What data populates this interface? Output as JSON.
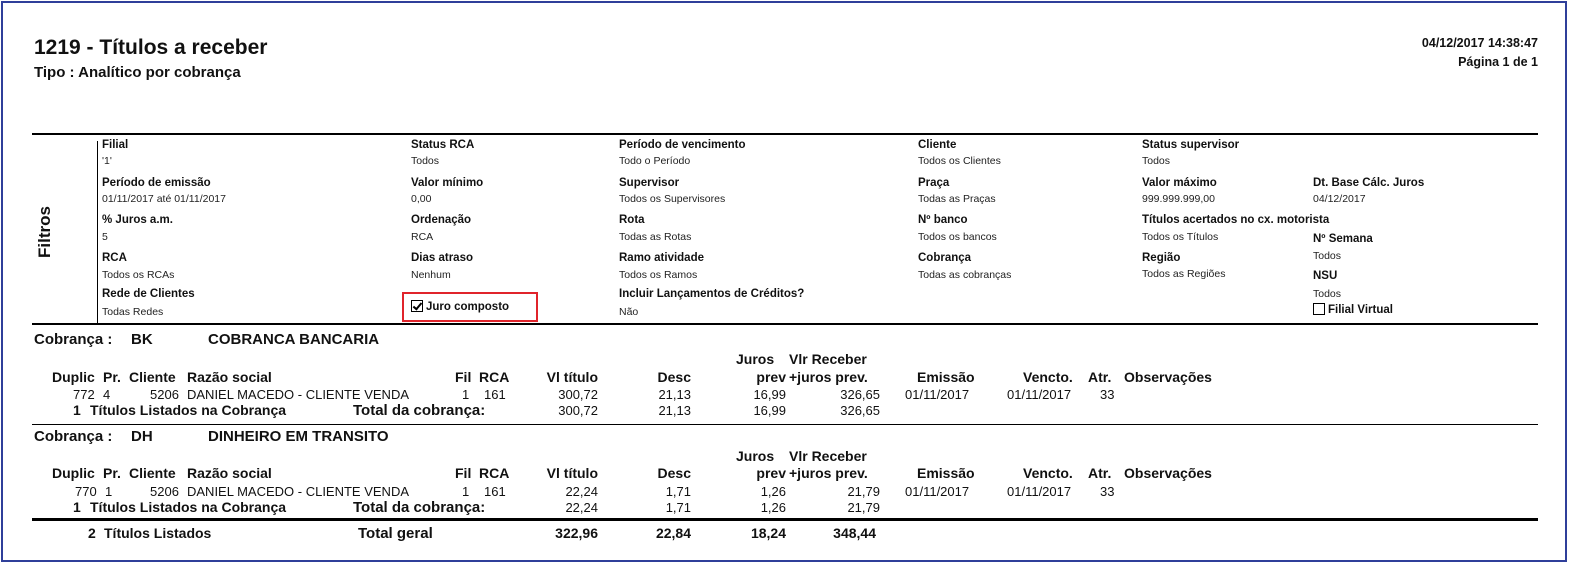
{
  "report": {
    "title": "1219 - Títulos a receber",
    "subtitle": "Tipo : Analítico por cobrança",
    "datetime": "04/12/2017 14:38:47",
    "page": "Página 1 de 1"
  },
  "filters": {
    "label": "Filtros",
    "filial": {
      "label": "Filial",
      "value": "'1'"
    },
    "periodo_emissao": {
      "label": "Período de emissão",
      "value": "01/11/2017 até 01/11/2017"
    },
    "juros_am": {
      "label": "% Juros a.m.",
      "value": "5"
    },
    "rca": {
      "label": "RCA",
      "value": "Todos os RCAs"
    },
    "rede_clientes": {
      "label": "Rede de Clientes",
      "value": "Todas Redes"
    },
    "status_rca": {
      "label": "Status RCA",
      "value": "Todos"
    },
    "valor_minimo": {
      "label": "Valor mínimo",
      "value": "0,00"
    },
    "ordenacao": {
      "label": "Ordenação",
      "value": "RCA"
    },
    "dias_atraso": {
      "label": "Dias atraso",
      "value": "Nenhum"
    },
    "juro_composto": {
      "label": "Juro composto",
      "checked": true
    },
    "periodo_vencimento": {
      "label": "Período de vencimento",
      "value": "Todo o Período"
    },
    "supervisor": {
      "label": "Supervisor",
      "value": "Todos os Supervisores"
    },
    "rota": {
      "label": "Rota",
      "value": "Todas as Rotas"
    },
    "ramo_atividade": {
      "label": "Ramo atividade",
      "value": "Todos os Ramos"
    },
    "incluir_lancamentos": {
      "label": "Incluir Lançamentos de Créditos?",
      "value": "Não"
    },
    "cliente": {
      "label": "Cliente",
      "value": "Todos os Clientes"
    },
    "praca": {
      "label": "Praça",
      "value": "Todas as Praças"
    },
    "n_banco": {
      "label": "Nº banco",
      "value": "Todos os bancos"
    },
    "cobranca": {
      "label": "Cobrança",
      "value": "Todas as cobranças"
    },
    "status_supervisor": {
      "label": "Status supervisor",
      "value": "Todos"
    },
    "valor_maximo": {
      "label": "Valor máximo",
      "value": "999.999.999,00"
    },
    "titulos_acertados": {
      "label": "Títulos acertados no cx. motorista",
      "value": "Todos os Títulos"
    },
    "regiao": {
      "label": "Região",
      "value": "Todos as Regiões"
    },
    "dt_base": {
      "label": "Dt. Base Cálc. Juros",
      "value": "04/12/2017"
    },
    "n_semana": {
      "label": "Nº Semana",
      "value": "Todos"
    },
    "nsu": {
      "label": "NSU",
      "value": "Todos"
    },
    "filial_virtual": {
      "label": "Filial Virtual",
      "checked": false
    }
  },
  "columns": {
    "duplic": "Duplic",
    "pr": "Pr.",
    "cliente": "Cliente",
    "razao": "Razão social",
    "fil": "Fil",
    "rca": "RCA",
    "vl_titulo": "Vl título",
    "desc": "Desc",
    "juros_1": "Juros",
    "juros_2": "prev",
    "vlr_1": "Vlr Receber",
    "vlr_2": "+juros prev.",
    "emissao": "Emissão",
    "vencto": "Vencto.",
    "atr": "Atr.",
    "obs": "Observações"
  },
  "sections": [
    {
      "label": "Cobrança :",
      "code": "BK",
      "name": "COBRANCA BANCARIA",
      "row": {
        "duplic": "772",
        "pr": "4",
        "cliente": "5206",
        "razao": "DANIEL MACEDO - CLIENTE VENDA",
        "fil": "1",
        "rca": "161",
        "vl_titulo": "300,72",
        "desc": "21,13",
        "juros": "16,99",
        "vlr": "326,65",
        "emissao": "01/11/2017",
        "vencto": "01/11/2017",
        "atr": "33"
      },
      "summary": {
        "count": "1",
        "listed": "Títulos Listados na Cobrança",
        "total_label": "Total da cobrança:",
        "vl_titulo": "300,72",
        "desc": "21,13",
        "juros": "16,99",
        "vlr": "326,65"
      }
    },
    {
      "label": "Cobrança :",
      "code": "DH",
      "name": "DINHEIRO EM TRANSITO",
      "row": {
        "duplic": "770",
        "pr": "1",
        "cliente": "5206",
        "razao": "DANIEL MACEDO - CLIENTE VENDA",
        "fil": "1",
        "rca": "161",
        "vl_titulo": "22,24",
        "desc": "1,71",
        "juros": "1,26",
        "vlr": "21,79",
        "emissao": "01/11/2017",
        "vencto": "01/11/2017",
        "atr": "33"
      },
      "summary": {
        "count": "1",
        "listed": "Títulos Listados na Cobrança",
        "total_label": "Total da cobrança:",
        "vl_titulo": "22,24",
        "desc": "1,71",
        "juros": "1,26",
        "vlr": "21,79"
      }
    }
  ],
  "grand_total": {
    "count": "2",
    "listed": "Títulos Listados",
    "label": "Total geral",
    "vl_titulo": "322,96",
    "desc": "22,84",
    "juros": "18,24",
    "vlr": "348,44"
  }
}
